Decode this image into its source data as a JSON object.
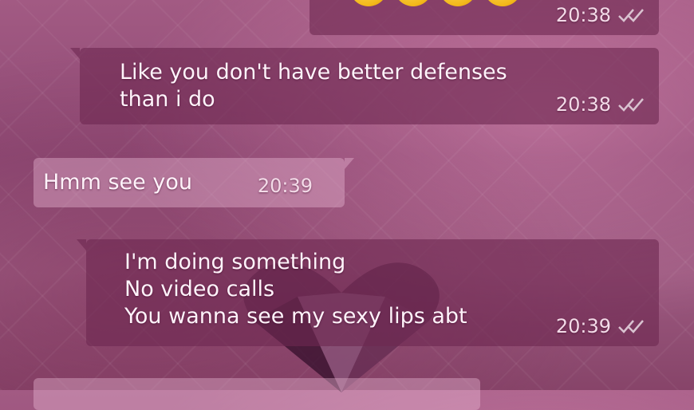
{
  "messages": [
    {
      "id": "m0",
      "direction": "outgoing",
      "text": "",
      "emoji_count": 4,
      "time": "20:38",
      "status": "read"
    },
    {
      "id": "m1",
      "direction": "outgoing",
      "text": "Like you don't have better defenses\nthan i do",
      "time": "20:38",
      "status": "read"
    },
    {
      "id": "m2",
      "direction": "incoming",
      "text": "Hmm see you",
      "time": "20:39"
    },
    {
      "id": "m3",
      "direction": "outgoing",
      "text": "I'm doing something\nNo video calls\nYou wanna see my sexy lips abt",
      "time": "20:39",
      "status": "read"
    }
  ],
  "icons": {
    "read_receipt": "double-check-icon",
    "emoji": "slightly-smiling-face-icon"
  },
  "colors": {
    "outgoing_bubble": "#6e2850",
    "incoming_bubble": "#e6b4d2",
    "background": "#9c5a80",
    "text": "#fff3fa"
  }
}
